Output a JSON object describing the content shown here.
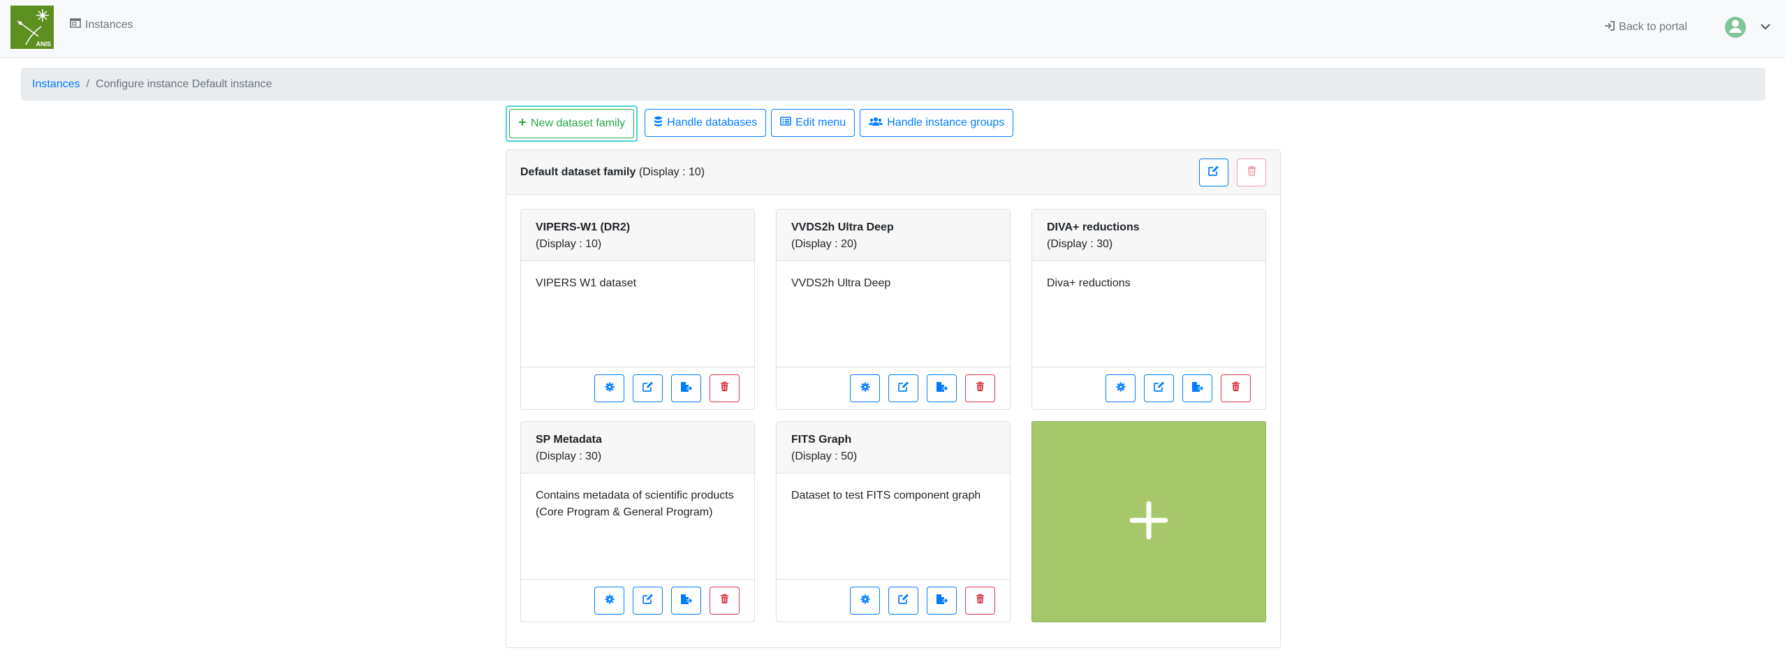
{
  "navbar": {
    "logo_text": "ANIS",
    "instances_label": "Instances",
    "back_label": "Back to portal"
  },
  "breadcrumb": {
    "link": "Instances",
    "separator": "/",
    "current": "Configure instance Default instance"
  },
  "actions": {
    "new_family": "New dataset family",
    "handle_databases": "Handle databases",
    "edit_menu": "Edit menu",
    "handle_groups": "Handle instance groups"
  },
  "family": {
    "name": "Default dataset family",
    "display": "(Display : 10)"
  },
  "datasets": [
    {
      "title": "VIPERS-W1 (DR2)",
      "display": "(Display : 10)",
      "description": "VIPERS W1 dataset"
    },
    {
      "title": "VVDS2h Ultra Deep",
      "display": "(Display : 20)",
      "description": "VVDS2h Ultra Deep"
    },
    {
      "title": "DIVA+ reductions",
      "display": "(Display : 30)",
      "description": "Diva+ reductions"
    },
    {
      "title": "SP Metadata",
      "display": "(Display : 30)",
      "description": "Contains metadata of scientific products (Core Program & General Program)"
    },
    {
      "title": "FITS Graph",
      "display": "(Display : 50)",
      "description": "Dataset to test FITS component graph"
    }
  ],
  "colors": {
    "primary": "#007bff",
    "success": "#28a745",
    "danger": "#dc3545",
    "add_tile": "#a6c86b",
    "logo": "#5c8f20"
  },
  "icons": {
    "instances": "window-icon",
    "back": "sign-in-icon",
    "new_family": "plus-icon",
    "databases": "database-icon",
    "menu": "list-alt-icon",
    "groups": "users-icon",
    "edit": "edit-icon",
    "delete": "trash-icon",
    "configure": "gear-icon",
    "import": "file-import-icon",
    "user": "user-circle-icon",
    "chevron": "chevron-down-icon"
  }
}
